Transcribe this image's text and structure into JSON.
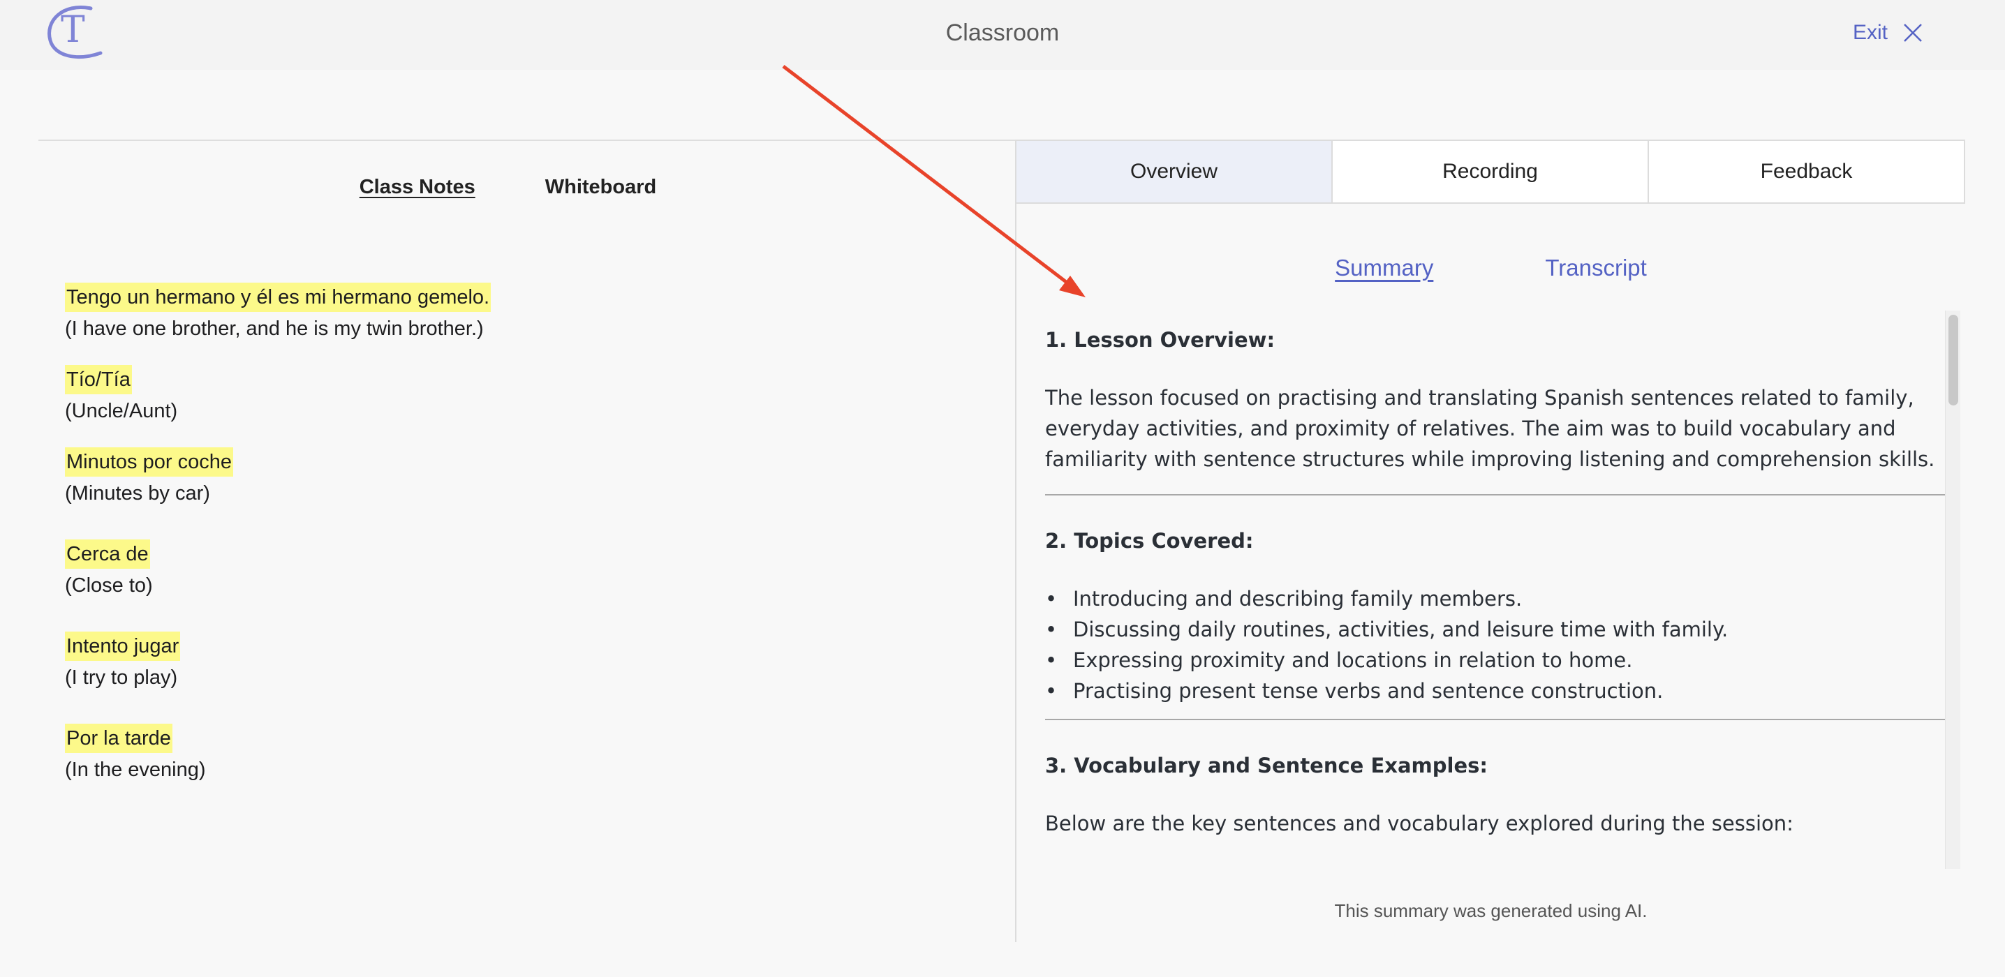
{
  "header": {
    "title": "Classroom",
    "exit_label": "Exit",
    "logo_letter": "T",
    "logo_color": "#7f84d6"
  },
  "left": {
    "tabs": [
      {
        "label": "Class Notes",
        "active": true
      },
      {
        "label": "Whiteboard",
        "active": false
      }
    ],
    "notes": [
      {
        "term": "Tengo un hermano y él es mi hermano gemelo.",
        "translation": "(I have one brother, and he is my twin brother.)"
      },
      {
        "term": "Tío/Tía",
        "translation": "(Uncle/Aunt)"
      },
      {
        "term": "Minutos por coche",
        "translation": "(Minutes by car)"
      },
      {
        "term": "Cerca de",
        "translation": "(Close to)"
      },
      {
        "term": "Intento jugar",
        "translation": "(I try to play)"
      },
      {
        "term": "Por la tarde",
        "translation": "(In the evening)"
      }
    ],
    "highlight_color": "#fcf98a"
  },
  "right": {
    "main_tabs": [
      {
        "label": "Overview",
        "active": true
      },
      {
        "label": "Recording",
        "active": false
      },
      {
        "label": "Feedback",
        "active": false
      }
    ],
    "sub_tabs": [
      {
        "label": "Summary",
        "active": true
      },
      {
        "label": "Transcript",
        "active": false
      }
    ],
    "summary": {
      "s1_title": "1. Lesson Overview:",
      "s1_text": "The lesson focused on practising and translating Spanish sentences related to family, everyday activities, and proximity of relatives. The aim was to build vocabulary and familiarity with sentence structures while improving listening and comprehension skills.",
      "s2_title": "2. Topics Covered:",
      "s2_items": [
        "Introducing and describing family members.",
        "Discussing daily routines, activities, and leisure time with family.",
        "Expressing proximity and locations in relation to home.",
        "Practising present tense verbs and sentence construction."
      ],
      "s3_title": "3. Vocabulary and Sentence Examples:",
      "s3_text": "Below are the key sentences and vocabulary explored during the session:"
    },
    "ai_note": "This summary was generated using AI.",
    "accent_color": "#5462c4"
  },
  "annotation": {
    "arrow_color": "#e8432a"
  }
}
